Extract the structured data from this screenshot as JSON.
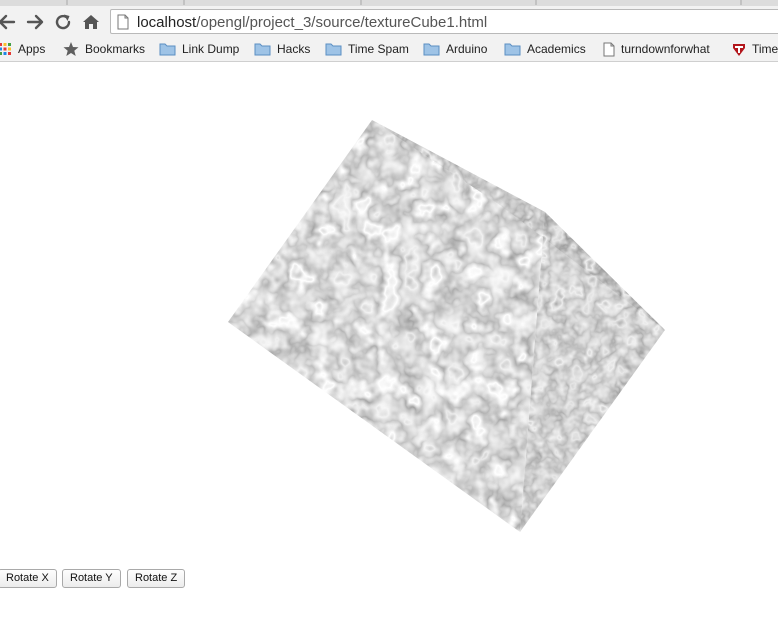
{
  "browser": {
    "url_host": "localhost",
    "url_path": "/opengl/project_3/source/textureCube1.html"
  },
  "bookmarks": [
    {
      "label": "Apps",
      "icon": "apps-grid-icon"
    },
    {
      "label": "Bookmarks",
      "icon": "star-icon"
    },
    {
      "label": "Link Dump",
      "icon": "folder-icon"
    },
    {
      "label": "Hacks",
      "icon": "folder-icon"
    },
    {
      "label": "Time Spam",
      "icon": "folder-icon"
    },
    {
      "label": "Arduino",
      "icon": "folder-icon"
    },
    {
      "label": "Academics",
      "icon": "folder-icon"
    },
    {
      "label": "turndownforwhat",
      "icon": "page-icon"
    },
    {
      "label": "Time",
      "icon": "site-favicon"
    }
  ],
  "scene": {
    "object": "textured cube",
    "texture": "grayscale bumpy noise"
  },
  "controls": {
    "rotate_x": "Rotate X",
    "rotate_y": "Rotate Y",
    "rotate_z": "Rotate Z"
  }
}
